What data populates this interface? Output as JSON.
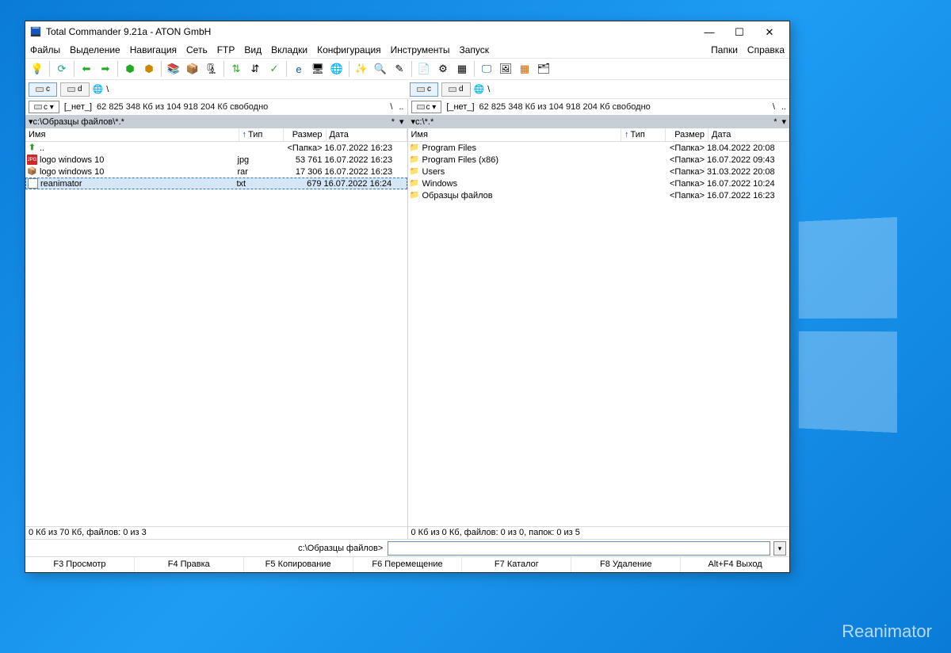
{
  "watermark": "Reanimator",
  "titlebar": {
    "title": "Total Commander 9.21a - ATON GmbH"
  },
  "menubar": {
    "items": [
      "Файлы",
      "Выделение",
      "Навигация",
      "Сеть",
      "FTP",
      "Вид",
      "Вкладки",
      "Конфигурация",
      "Инструменты",
      "Запуск"
    ],
    "right": [
      "Папки",
      "Справка"
    ]
  },
  "drives": {
    "c": "c",
    "d": "d",
    "root": "\\"
  },
  "panelL": {
    "drive_sel": "c ▾",
    "drive_label": "[_нет_]",
    "free": "62 825 348 Кб из 104 918 204 Кб свободно",
    "path": "c:\\Образцы файлов\\*.*",
    "cols": {
      "name": "Имя",
      "type": "Тип",
      "size": "Размер",
      "date": "Дата"
    },
    "files": [
      {
        "icon": "up",
        "name": "..",
        "type": "",
        "size": "<Папка>",
        "date": "16.07.2022 16:23",
        "sel": false
      },
      {
        "icon": "jpg",
        "name": "logo windows 10",
        "type": "jpg",
        "size": "53 761",
        "date": "16.07.2022 16:23",
        "sel": false
      },
      {
        "icon": "rar",
        "name": "logo windows 10",
        "type": "rar",
        "size": "17 306",
        "date": "16.07.2022 16:23",
        "sel": false
      },
      {
        "icon": "txt",
        "name": "reanimator",
        "type": "txt",
        "size": "679",
        "date": "16.07.2022 16:24",
        "sel": true
      }
    ],
    "status": "0 Кб из 70 Кб, файлов: 0 из 3"
  },
  "panelR": {
    "drive_sel": "c ▾",
    "drive_label": "[_нет_]",
    "free": "62 825 348 Кб из 104 918 204 Кб свободно",
    "path": "c:\\*.*",
    "cols": {
      "name": "Имя",
      "type": "Тип",
      "size": "Размер",
      "date": "Дата"
    },
    "files": [
      {
        "icon": "folder",
        "name": "Program Files",
        "type": "",
        "size": "<Папка>",
        "date": "18.04.2022 20:08"
      },
      {
        "icon": "folder",
        "name": "Program Files (x86)",
        "type": "",
        "size": "<Папка>",
        "date": "16.07.2022 09:43"
      },
      {
        "icon": "folder",
        "name": "Users",
        "type": "",
        "size": "<Папка>",
        "date": "31.03.2022 20:08"
      },
      {
        "icon": "folder",
        "name": "Windows",
        "type": "",
        "size": "<Папка>",
        "date": "16.07.2022 10:24"
      },
      {
        "icon": "folder",
        "name": "Образцы файлов",
        "type": "",
        "size": "<Папка>",
        "date": "16.07.2022 16:23"
      }
    ],
    "status": "0 Кб из 0 Кб, файлов: 0 из 0, папок: 0 из 5"
  },
  "cmd": {
    "prompt": "c:\\Образцы файлов>"
  },
  "fn": {
    "f3": "F3 Просмотр",
    "f4": "F4 Правка",
    "f5": "F5 Копирование",
    "f6": "F6 Перемещение",
    "f7": "F7 Каталог",
    "f8": "F8 Удаление",
    "alt": "Alt+F4 Выход"
  },
  "end_icons": {
    "slash": "\\",
    "dots": ".."
  }
}
